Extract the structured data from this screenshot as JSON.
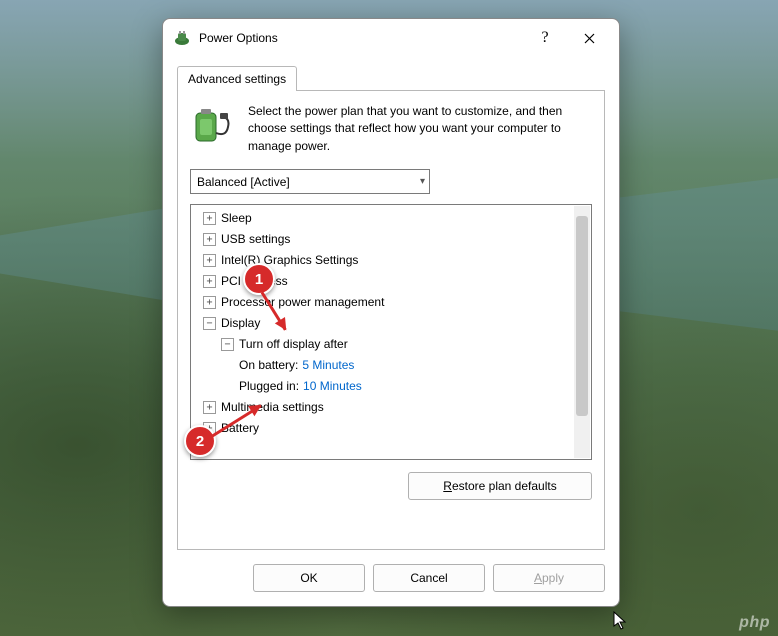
{
  "window": {
    "title": "Power Options",
    "help_label": "?",
    "close_label": "Close"
  },
  "tab": {
    "label": "Advanced settings"
  },
  "intro": {
    "text": "Select the power plan that you want to customize, and then choose settings that reflect how you want your computer to manage power."
  },
  "plan_selector": {
    "selected": "Balanced [Active]"
  },
  "tree": {
    "items": [
      {
        "label": "Sleep",
        "expanded": false,
        "level": 1
      },
      {
        "label": "USB settings",
        "expanded": false,
        "level": 1
      },
      {
        "label": "Intel(R) Graphics Settings",
        "expanded": false,
        "level": 1
      },
      {
        "label": "PCI Express",
        "expanded": false,
        "level": 1
      },
      {
        "label": "Processor power management",
        "expanded": false,
        "level": 1
      },
      {
        "label": "Display",
        "expanded": true,
        "level": 1
      },
      {
        "label": "Turn off display after",
        "expanded": true,
        "level": 2
      },
      {
        "label": "On battery:",
        "value": "5 Minutes",
        "level": 3
      },
      {
        "label": "Plugged in:",
        "value": "10 Minutes",
        "level": 3
      },
      {
        "label": "Multimedia settings",
        "expanded": false,
        "level": 1
      },
      {
        "label": "Battery",
        "expanded": false,
        "level": 1
      }
    ]
  },
  "buttons": {
    "restore": "Restore plan defaults",
    "ok": "OK",
    "cancel": "Cancel",
    "apply": "Apply"
  },
  "annotations": {
    "badge1": "1",
    "badge2": "2"
  },
  "watermark": "php"
}
